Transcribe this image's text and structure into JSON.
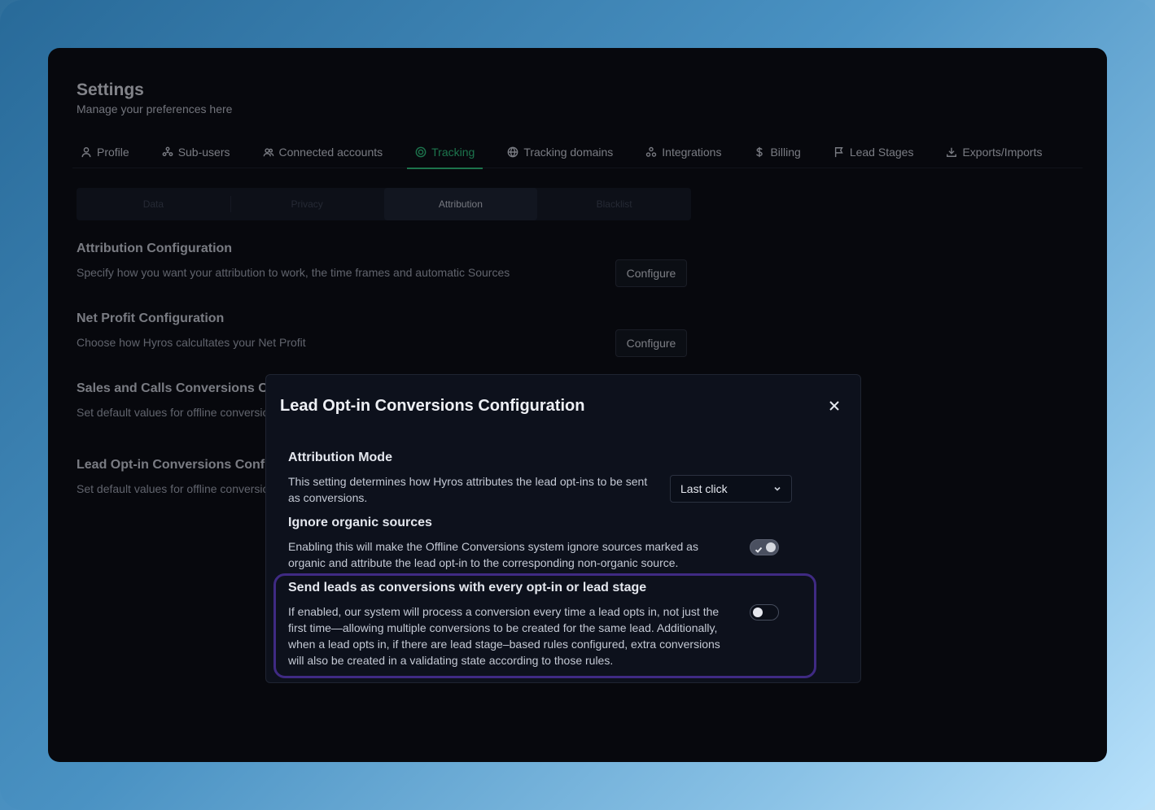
{
  "page": {
    "title": "Settings",
    "subtitle": "Manage your preferences here"
  },
  "tabs": [
    {
      "label": "Profile",
      "icon": "user-icon"
    },
    {
      "label": "Sub-users",
      "icon": "sub-users-icon"
    },
    {
      "label": "Connected accounts",
      "icon": "users-icon"
    },
    {
      "label": "Tracking",
      "icon": "target-icon",
      "active": true
    },
    {
      "label": "Tracking domains",
      "icon": "globe-icon"
    },
    {
      "label": "Integrations",
      "icon": "integrations-icon"
    },
    {
      "label": "Billing",
      "icon": "dollar-icon"
    },
    {
      "label": "Lead Stages",
      "icon": "flag-icon"
    },
    {
      "label": "Exports/Imports",
      "icon": "download-icon"
    }
  ],
  "subtabs": [
    {
      "label": "Data"
    },
    {
      "label": "Privacy"
    },
    {
      "label": "Attribution",
      "active": true
    },
    {
      "label": "Blacklist"
    }
  ],
  "sections": {
    "attribution": {
      "title": "Attribution Configuration",
      "desc": "Specify how you want your attribution to work, the time frames and automatic Sources",
      "button": "Configure"
    },
    "net_profit": {
      "title": "Net Profit Configuration",
      "desc": "Choose how Hyros calcultates your Net Profit",
      "button": "Configure"
    },
    "sales_calls": {
      "title": "Sales and Calls Conversions Co",
      "desc": "Set default values for offline conversio"
    },
    "lead_optin": {
      "title": "Lead Opt-in Conversions Config",
      "desc": "Set default values for offline conversio"
    }
  },
  "modal": {
    "title": "Lead Opt-in Conversions Configuration",
    "attribution_mode": {
      "title": "Attribution Mode",
      "desc": "This setting determines how Hyros attributes the lead opt-ins to be sent as conversions.",
      "selected": "Last click"
    },
    "ignore_organic": {
      "title": "Ignore organic sources",
      "desc": "Enabling this will make the Offline Conversions system ignore sources marked as organic and attribute the lead opt-in to the corresponding non-organic source.",
      "enabled": true
    },
    "send_leads": {
      "title": "Send leads as conversions with every opt-in or lead stage",
      "desc": "If enabled, our system will process a conversion every time a lead opts in, not just the first time—allowing multiple conversions to be created for the same lead. Additionally, when a lead opts in, if there are lead stage–based rules configured, extra conversions will also be created in a validating state according to those rules.",
      "enabled": false
    }
  },
  "colors": {
    "accent": "#2ecc80",
    "highlight": "#3f2a83",
    "window_bg": "#07080d",
    "modal_bg": "#0d111c"
  }
}
